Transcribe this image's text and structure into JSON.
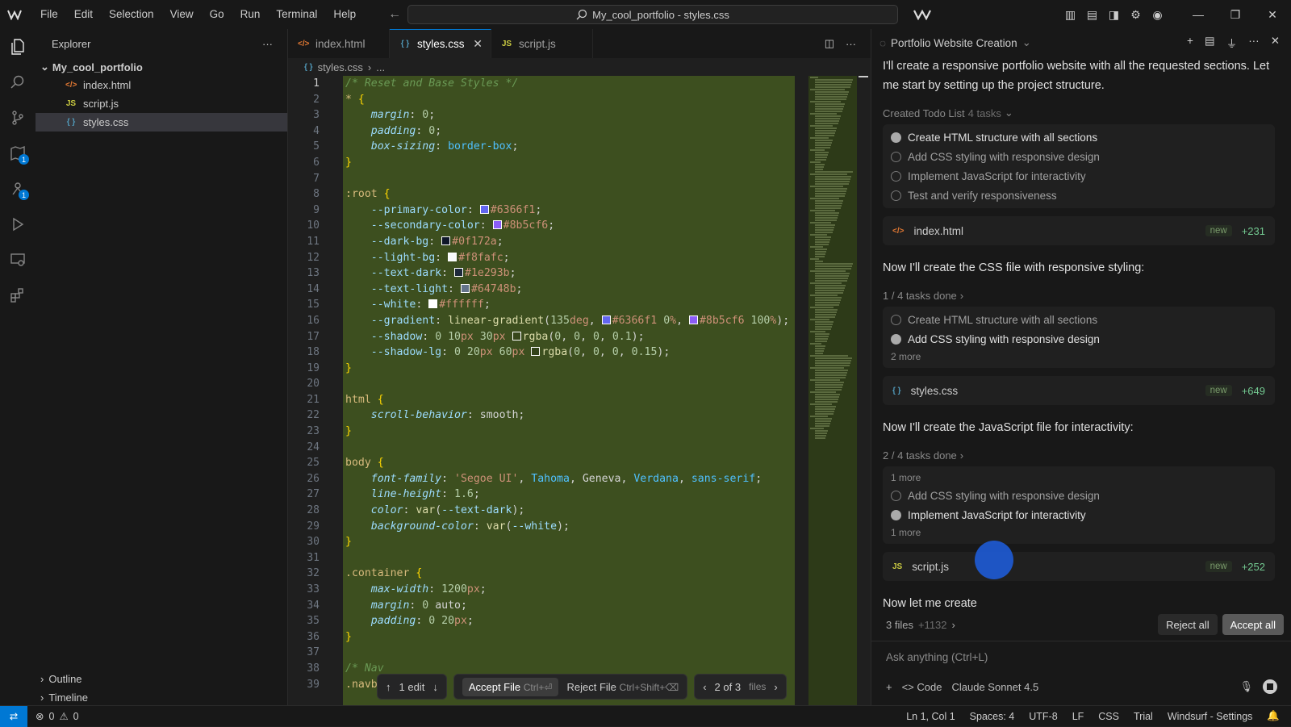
{
  "menu": [
    "File",
    "Edit",
    "Selection",
    "View",
    "Go",
    "Run",
    "Terminal",
    "Help"
  ],
  "search": {
    "text": "My_cool_portfolio - styles.css"
  },
  "explorer": {
    "title": "Explorer",
    "root": "My_cool_portfolio",
    "files": [
      {
        "name": "index.html",
        "type": "html",
        "icon": "</>"
      },
      {
        "name": "script.js",
        "type": "js",
        "icon": "JS"
      },
      {
        "name": "styles.css",
        "type": "css",
        "icon": "{ }"
      }
    ],
    "outline": "Outline",
    "timeline": "Timeline"
  },
  "activity_badges": {
    "extensions": "1",
    "run": "1"
  },
  "tabs": [
    {
      "label": "index.html",
      "icon": "</>",
      "type": "html"
    },
    {
      "label": "styles.css",
      "icon": "{ }",
      "type": "css"
    },
    {
      "label": "script.js",
      "icon": "JS",
      "type": "js"
    }
  ],
  "breadcrumb": {
    "file": "styles.css",
    "rest": "..."
  },
  "line_numbers": [
    "1",
    "2",
    "3",
    "4",
    "5",
    "6",
    "7",
    "8",
    "9",
    "10",
    "11",
    "12",
    "13",
    "14",
    "15",
    "16",
    "17",
    "18",
    "19",
    "20",
    "21",
    "22",
    "23",
    "24",
    "25",
    "26",
    "27",
    "28",
    "29",
    "30",
    "31",
    "32",
    "33",
    "34",
    "35",
    "36",
    "37",
    "38",
    "39"
  ],
  "review": {
    "edit_count": "1 edit",
    "accept": "Accept File",
    "accept_key": "Ctrl+⏎",
    "reject": "Reject File",
    "reject_key": "Ctrl+Shift+⌫",
    "position": "2 of 3",
    "files_word": "files"
  },
  "chat": {
    "title": "Portfolio Website Creation",
    "intro": "I'll create a responsive portfolio website with all the requested sections. Let me start by setting up the project structure.",
    "todo_label": "Created Todo List",
    "todo_count": "4 tasks",
    "todos": [
      {
        "text": "Create HTML structure with all sections",
        "state": "active"
      },
      {
        "text": "Add CSS styling with responsive design",
        "state": "pending"
      },
      {
        "text": "Implement JavaScript for interactivity",
        "state": "pending"
      },
      {
        "text": "Test and verify responsiveness",
        "state": "pending"
      }
    ],
    "card1": {
      "name": "index.html",
      "badge": "new",
      "plus": "+231"
    },
    "msg2": "Now I'll create the CSS file with responsive styling:",
    "progress1": "1 / 4 tasks done",
    "group1": [
      {
        "text": "Create HTML structure with all sections",
        "state": "done"
      },
      {
        "text": "Add CSS styling with responsive design",
        "state": "active"
      }
    ],
    "group1_more": "2 more",
    "card2": {
      "name": "styles.css",
      "badge": "new",
      "plus": "+649"
    },
    "msg3": "Now I'll create the JavaScript file for interactivity:",
    "progress2": "2 / 4 tasks done",
    "group2_more_top": "1 more",
    "group2": [
      {
        "text": "Add CSS styling with responsive design",
        "state": "done"
      },
      {
        "text": "Implement JavaScript for interactivity",
        "state": "active"
      }
    ],
    "group2_more": "1 more",
    "card3": {
      "name": "script.js",
      "badge": "new",
      "plus": "+252"
    },
    "msg4": "Now let me create",
    "files_summary": "3 files",
    "files_plus": "+1132",
    "reject_all": "Reject all",
    "accept_all": "Accept all",
    "ask_placeholder": "Ask anything (Ctrl+L)",
    "mode": "Code",
    "model": "Claude Sonnet 4.5"
  },
  "status": {
    "errors": "0",
    "warnings": "0",
    "position": "Ln 1, Col 1",
    "spaces": "Spaces: 4",
    "encoding": "UTF-8",
    "eol": "LF",
    "language": "CSS",
    "trial": "Trial",
    "settings": "Windsurf - Settings"
  },
  "colors": {
    "accent": "#0078d4",
    "diff_bg": "#3d4f1f",
    "primary": "#6366f1",
    "secondary": "#8b5cf6"
  }
}
